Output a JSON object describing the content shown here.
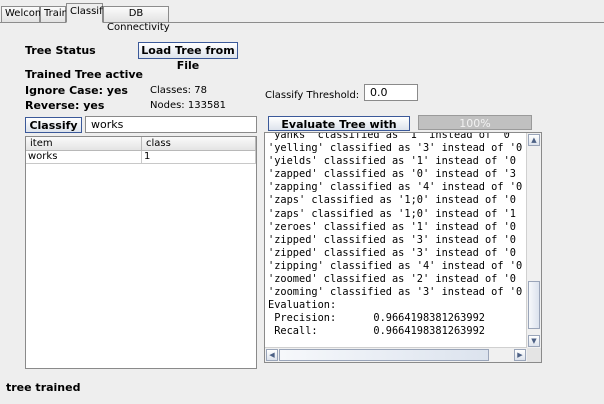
{
  "tabs": [
    "Welcome",
    "Train",
    "Classify",
    "DB Connectivity"
  ],
  "active_tab": "Classify",
  "tree_status": {
    "heading": "Tree Status",
    "load_button": "Load Tree from File",
    "trained": "Trained Tree active",
    "ignore_case": "Ignore Case: yes",
    "reverse": "Reverse: yes",
    "classes": "Classes: 78",
    "nodes": "Nodes: 133581",
    "threshold_label": "Classify Threshold:",
    "threshold_value": "0.0"
  },
  "classify": {
    "button": "Classify",
    "input_value": "works",
    "table": {
      "columns": [
        "item",
        "class"
      ],
      "rows": [
        [
          "works",
          "1"
        ]
      ]
    }
  },
  "evaluate": {
    "button": "Evaluate Tree with File",
    "progress_label": "100%",
    "progress": 1.0,
    "log": [
      "'yanks' classified as '1' instead of '0",
      "'yelling' classified as '3' instead of '0",
      "'yields' classified as '1' instead of '0",
      "'zapped' classified as '0' instead of '3",
      "'zapping' classified as '4' instead of '0",
      "'zaps' classified as '1;0' instead of '0",
      "'zaps' classified as '1;0' instead of '1",
      "'zeroes' classified as '1' instead of '0",
      "'zipped' classified as '3' instead of '0",
      "'zipped' classified as '3' instead of '0",
      "'zipping' classified as '4' instead of '0",
      "'zoomed' classified as '2' instead of '0",
      "'zooming' classified as '3' instead of '0",
      "Evaluation:",
      " Precision:      0.9664198381263992",
      " Recall:         0.9664198381263992"
    ]
  },
  "status_bar": "tree trained",
  "icons": {
    "scroll_up": "chevron-up-icon",
    "scroll_down": "chevron-down-icon",
    "scroll_left": "chevron-left-icon",
    "scroll_right": "chevron-right-icon"
  }
}
